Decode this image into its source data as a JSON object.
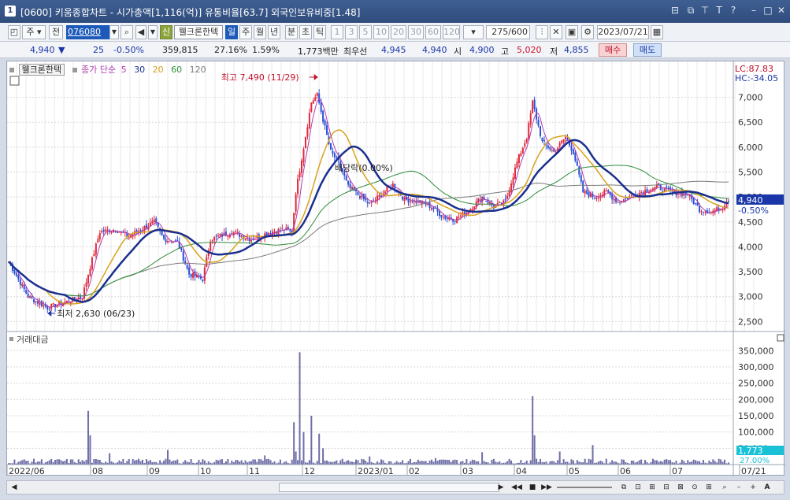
{
  "window": {
    "app_icon": "1",
    "title": "[0600] 키움종합차트 - 시가총액[1,116(억)] 유통비율[63.7] 외국인보유비중[1.48]"
  },
  "toolbar": {
    "type_main": "주",
    "type_prev": "전",
    "stock_code": "076080",
    "new_label": "신",
    "stock_name": "웰크론한텍",
    "periods": [
      "일",
      "주",
      "월",
      "년",
      "분",
      "초",
      "틱"
    ],
    "minutes": [
      "1",
      "3",
      "5",
      "10",
      "20",
      "30",
      "60",
      "120"
    ],
    "count": "275",
    "count_max": "/600",
    "date": "2023/07/21"
  },
  "quote": {
    "price": "4,940",
    "change_arrow": "▼",
    "change": "25",
    "change_pct": "-0.50%",
    "volume": "359,815",
    "turnover_pct": "27.16%",
    "ratio": "1.59%",
    "amount": "1,773백만",
    "best_label": "최우선",
    "best_ask": "4,945",
    "best_bid": "4,940",
    "open_label": "시",
    "open": "4,900",
    "high_label": "고",
    "high": "5,020",
    "low_label": "저",
    "low": "4,855",
    "buy_label": "매수",
    "sell_label": "매도"
  },
  "chart_data": {
    "type": "candlestick",
    "stock_name": "웰크론한텍",
    "legend": {
      "prefix": "종가 단순",
      "periods": [
        {
          "label": "5",
          "color": "#b03cb0"
        },
        {
          "label": "30",
          "color": "#1a2f8f"
        },
        {
          "label": "20",
          "color": "#d9a21c"
        },
        {
          "label": "60",
          "color": "#2e8b3a"
        },
        {
          "label": "120",
          "color": "#7a7a7a"
        }
      ]
    },
    "y_ticks": [
      "7,000",
      "6,500",
      "6,000",
      "5,500",
      "5,000",
      "4,500",
      "4,000",
      "3,500",
      "3,000",
      "2,500"
    ],
    "y_ticks_values": [
      7000,
      6500,
      6000,
      5500,
      5000,
      4500,
      4000,
      3500,
      3000,
      2500
    ],
    "ylim": [
      2300,
      7720
    ],
    "x_ticks": [
      "2022/06",
      "08",
      "09",
      "10",
      "11",
      "12",
      "2023/01",
      "02",
      "03",
      "04",
      "05",
      "06",
      "07",
      "07/21"
    ],
    "max_annotation": "최고 7,490 (11/29)",
    "min_annotation": "최저 2,630 (06/23)",
    "dividend_annotation": "배당락(0.00%)",
    "current_price_label": "4,940",
    "current_change_label": "-0.50%",
    "lc_label": "LC:87.83",
    "hc_label": "HC:-34.05",
    "ma_colors": {
      "ma5": "#b03cb0",
      "ma20": "#d9a21c",
      "ma30": "#1a2f8f",
      "ma60": "#2e8b3a",
      "ma120": "#7a7a7a"
    },
    "up_color": "#e0283a",
    "down_color": "#2a4fd6",
    "price_key_points": [
      [
        0,
        3700
      ],
      [
        10,
        3000
      ],
      [
        20,
        2780
      ],
      [
        30,
        2900
      ],
      [
        38,
        3000
      ],
      [
        42,
        3600
      ],
      [
        47,
        4300
      ],
      [
        55,
        4350
      ],
      [
        62,
        4200
      ],
      [
        68,
        4350
      ],
      [
        75,
        4500
      ],
      [
        80,
        4150
      ],
      [
        87,
        4100
      ],
      [
        93,
        3450
      ],
      [
        100,
        3350
      ],
      [
        104,
        4150
      ],
      [
        115,
        4300
      ],
      [
        125,
        4150
      ],
      [
        135,
        4300
      ],
      [
        142,
        4350
      ],
      [
        146,
        4300
      ],
      [
        148,
        5100
      ],
      [
        152,
        6000
      ],
      [
        156,
        6900
      ],
      [
        159,
        7050
      ],
      [
        162,
        6550
      ],
      [
        166,
        5900
      ],
      [
        170,
        5700
      ],
      [
        175,
        5200
      ],
      [
        180,
        5050
      ],
      [
        186,
        4850
      ],
      [
        192,
        5050
      ],
      [
        198,
        5250
      ],
      [
        204,
        4950
      ],
      [
        212,
        4900
      ],
      [
        218,
        4800
      ],
      [
        224,
        4600
      ],
      [
        230,
        4550
      ],
      [
        236,
        4700
      ],
      [
        244,
        5000
      ],
      [
        250,
        4800
      ],
      [
        256,
        4900
      ],
      [
        262,
        5700
      ],
      [
        267,
        6200
      ],
      [
        270,
        6900
      ],
      [
        275,
        6100
      ],
      [
        281,
        5900
      ],
      [
        287,
        6200
      ],
      [
        291,
        5900
      ],
      [
        296,
        5100
      ],
      [
        302,
        5000
      ],
      [
        308,
        5100
      ],
      [
        314,
        4900
      ],
      [
        320,
        5000
      ],
      [
        326,
        5100
      ],
      [
        334,
        5200
      ],
      [
        342,
        5100
      ],
      [
        350,
        5050
      ],
      [
        356,
        4750
      ],
      [
        362,
        4700
      ],
      [
        368,
        4800
      ],
      [
        370,
        4940
      ]
    ],
    "volume_axis_ticks": [
      "350,000",
      "300,000",
      "250,000",
      "200,000",
      "150,000",
      "100,000",
      "50,000"
    ],
    "volume_axis_values": [
      350000,
      300000,
      250000,
      200000,
      150000,
      100000,
      50000
    ],
    "volume_max": 370000,
    "volume_label": "거래대금",
    "volume_current_label": "1,773",
    "volume_current_label2": "27.00%",
    "volume_spikes": [
      [
        41,
        165000
      ],
      [
        42,
        90000
      ],
      [
        52,
        35000
      ],
      [
        82,
        45000
      ],
      [
        132,
        28000
      ],
      [
        147,
        130000
      ],
      [
        148,
        40000
      ],
      [
        150,
        345000
      ],
      [
        152,
        100000
      ],
      [
        156,
        150000
      ],
      [
        160,
        95000
      ],
      [
        162,
        50000
      ],
      [
        186,
        25000
      ],
      [
        220,
        20000
      ],
      [
        244,
        38000
      ],
      [
        270,
        210000
      ],
      [
        271,
        90000
      ],
      [
        284,
        40000
      ],
      [
        301,
        60000
      ]
    ]
  },
  "scroll": {
    "icons": [
      "play-icon",
      "stop-icon",
      "fast-forward-icon",
      "zoom-out-icon",
      "zoom-in-icon"
    ]
  }
}
